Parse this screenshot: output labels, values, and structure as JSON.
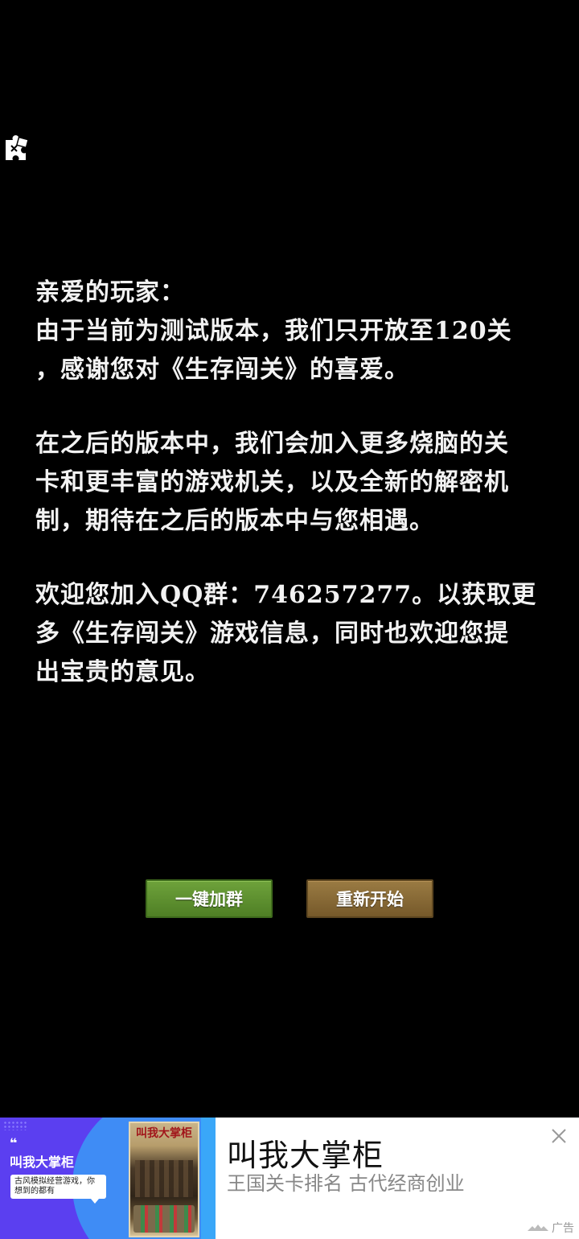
{
  "message": {
    "paragraphs": [
      [
        "亲爱的玩家：",
        "由于当前为测试版本，我们只开放至120关",
        "，感谢您对《生存闯关》的喜爱。"
      ],
      [
        "在之后的版本中，我们会加入更多烧脑的关",
        "卡和更丰富的游戏机关，以及全新的解密机",
        "制，期待在之后的版本中与您相遇。"
      ],
      [
        "欢迎您加入QQ群：746257277。以获取更",
        "多《生存闯关》游戏信息，同时也欢迎您提",
        "出宝贵的意见。"
      ]
    ]
  },
  "buttons": {
    "join_group": "一键加群",
    "restart": "重新开始"
  },
  "ad": {
    "quote": "❝",
    "brand_small": "叫我大掌柜",
    "bubble": "古风模拟经营游戏，你想到的都有",
    "poster_title": "叫我大掌柜",
    "title": "叫我大掌柜",
    "subtitle": "王国关卡排名 古代经商创业",
    "tag": "广告"
  },
  "icons": {
    "top_left": "puzzle-piece-icon",
    "close": "close-icon"
  },
  "colors": {
    "background": "#000000",
    "join_button": "#5e922f",
    "restart_button": "#8a6c38",
    "ad_accent": "#5b3ff0"
  }
}
